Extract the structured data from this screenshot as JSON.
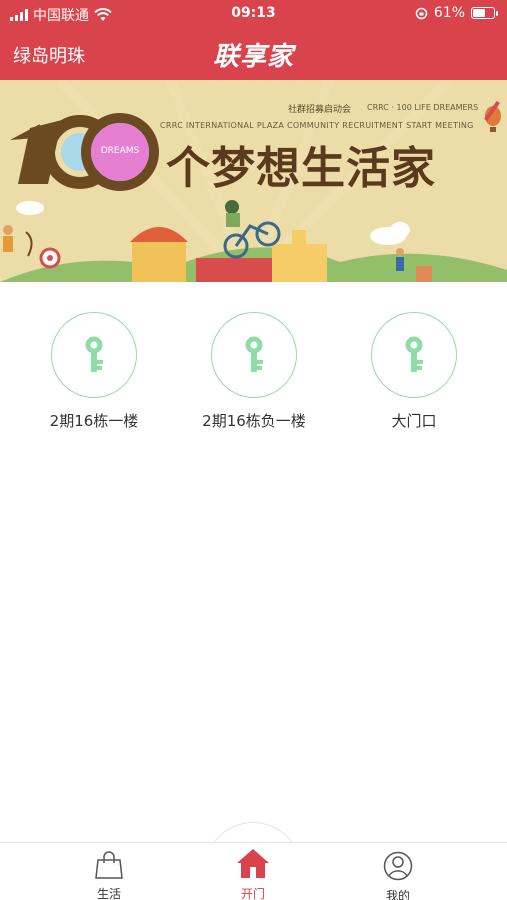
{
  "status_bar": {
    "carrier": "中国联通",
    "time": "09:13",
    "battery_percent": "61%",
    "battery_level": 0.61,
    "icons": [
      "signal-icon",
      "wifi-icon",
      "orientation-lock-icon",
      "battery-icon"
    ]
  },
  "header": {
    "community_name": "绿岛明珠",
    "brand_logo": "联享家"
  },
  "banner": {
    "top_text_cn": "社群招募启动会",
    "top_text_en": "CRRC · 100 LIFE DREAMERS",
    "subtitle_en": "CRRC INTERNATIONAL PLAZA COMMUNITY RECRUITMENT START MEETING",
    "number": "100",
    "dreams_label": "DREAMS",
    "title_cn": "个梦想生活家"
  },
  "doors": [
    {
      "label": "2期16栋一楼",
      "icon": "key-icon"
    },
    {
      "label": "2期16栋负一楼",
      "icon": "key-icon"
    },
    {
      "label": "大门口",
      "icon": "key-icon"
    }
  ],
  "tab_bar": {
    "tabs": [
      {
        "label": "生活",
        "icon": "shopping-bag-icon",
        "active": false
      },
      {
        "label": "开门",
        "icon": "home-icon",
        "active": true
      },
      {
        "label": "我的",
        "icon": "user-icon",
        "active": false
      }
    ]
  },
  "colors": {
    "primary_red": "#d9434b",
    "key_green": "#8fdca7",
    "banner_bg": "#ecdca7",
    "title_brown": "#5a3a1c"
  }
}
